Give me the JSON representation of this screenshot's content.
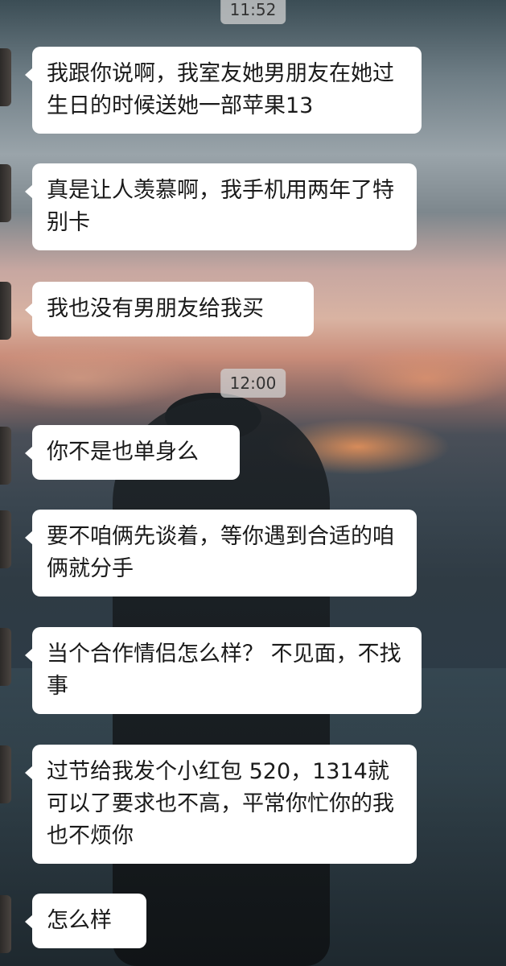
{
  "chat": {
    "timestamps": [
      "11:52",
      "12:00"
    ],
    "messages": [
      "我跟你说啊，我室友她男朋友在她过生日的时候送她一部苹果13",
      "真是让人羡慕啊，我手机用两年了特别卡",
      "我也没有男朋友给我买",
      "你不是也单身么",
      "要不咱俩先谈着，等你遇到合适的咱俩就分手",
      "当个合作情侣怎么样？ 不见面，不找事",
      "过节给我发个小红包 520，1314就可以了要求也不高，平常你忙你的我也不烦你",
      "怎么样"
    ]
  }
}
